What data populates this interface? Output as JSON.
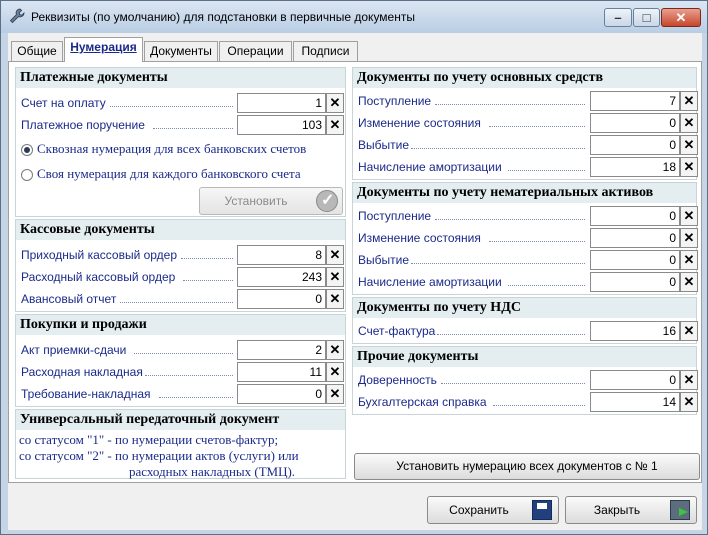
{
  "window": {
    "title": "Реквизиты (по умолчанию) для подстановки в первичные документы",
    "minimize_glyph": "–",
    "maximize_glyph": "□",
    "close_glyph": "✕"
  },
  "tabs": [
    "Общие",
    "Нумерация",
    "Документы",
    "Операции",
    "Подписи"
  ],
  "active_tab": "Нумерация",
  "payment": {
    "title": "Платежные документы",
    "rows": [
      {
        "label": "Счет на оплату",
        "value": "1"
      },
      {
        "label": "Платежное поручение",
        "value": "103"
      }
    ],
    "radio": [
      {
        "label": "Сквозная нумерация для всех банковских счетов",
        "selected": true
      },
      {
        "label": "Своя нумерация для каждого банковского счета",
        "selected": false
      }
    ],
    "set_button": "Установить"
  },
  "cash": {
    "title": "Кассовые документы",
    "rows": [
      {
        "label": "Приходный кассовый ордер",
        "value": "8"
      },
      {
        "label": "Расходный кассовый ордер",
        "value": "243"
      },
      {
        "label": "Авансовый отчет",
        "value": "0"
      }
    ]
  },
  "sales": {
    "title": "Покупки и продажи",
    "rows": [
      {
        "label": "Акт приемки-сдачи",
        "value": "2"
      },
      {
        "label": "Расходная накладная",
        "value": "11"
      },
      {
        "label": "Требование-накладная",
        "value": "0"
      }
    ]
  },
  "udoc": {
    "title": "Универсальный передаточный документ",
    "line1": "со статусом \"1\" - по нумерации счетов-фактур;",
    "line2": "со статусом \"2\" - по нумерации актов (услуги)  или",
    "line3": "расходных накладных (ТМЦ)."
  },
  "fixed_assets": {
    "title": "Документы по учету основных средств",
    "rows": [
      {
        "label": "Поступление",
        "value": "7"
      },
      {
        "label": "Изменение состояния",
        "value": "0"
      },
      {
        "label": "Выбытие",
        "value": "0"
      },
      {
        "label": "Начисление амортизации",
        "value": "18"
      }
    ]
  },
  "intangible": {
    "title": "Документы по учету нематериальных активов",
    "rows": [
      {
        "label": "Поступление",
        "value": "0"
      },
      {
        "label": "Изменение состояния",
        "value": "0"
      },
      {
        "label": "Выбытие",
        "value": "0"
      },
      {
        "label": "Начисление амортизации",
        "value": "0"
      }
    ]
  },
  "vat": {
    "title": "Документы по учету НДС",
    "rows": [
      {
        "label": "Счет-фактура",
        "value": "16"
      }
    ]
  },
  "other": {
    "title": "Прочие документы",
    "rows": [
      {
        "label": "Доверенность",
        "value": "0"
      },
      {
        "label": "Бухгалтерская справка",
        "value": "14"
      }
    ]
  },
  "reset_button": "Установить нумерацию всех документов с № 1",
  "clear_glyph": "✕",
  "footer": {
    "save": "Сохранить",
    "close": "Закрыть"
  }
}
